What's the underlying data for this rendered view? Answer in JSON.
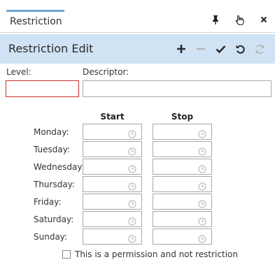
{
  "window": {
    "tab_label": "Restriction",
    "icons": [
      "pin-icon",
      "hand-pointer-icon",
      "close-icon"
    ]
  },
  "header": {
    "title": "Restriction Edit",
    "toolbar": [
      "add-icon",
      "remove-icon",
      "check-icon",
      "undo-icon",
      "refresh-icon"
    ]
  },
  "form": {
    "level_label": "Level:",
    "level_value": "",
    "descriptor_label": "Descriptor:",
    "descriptor_value": ""
  },
  "schedule": {
    "start_header": "Start",
    "stop_header": "Stop",
    "days": [
      {
        "label": "Monday:",
        "start": "",
        "stop": ""
      },
      {
        "label": "Tuesday:",
        "start": "",
        "stop": ""
      },
      {
        "label": "Wednesday:",
        "start": "",
        "stop": ""
      },
      {
        "label": "Thursday:",
        "start": "",
        "stop": ""
      },
      {
        "label": "Friday:",
        "start": "",
        "stop": ""
      },
      {
        "label": "Saturday:",
        "start": "",
        "stop": ""
      },
      {
        "label": "Sunday:",
        "start": "",
        "stop": ""
      }
    ]
  },
  "permission_checkbox": {
    "label": "This is a permission and not restriction",
    "checked": false
  },
  "colors": {
    "header_bg": "#cfe3f4",
    "tab_accent": "#6fa6d6",
    "error_border": "#c9302c",
    "toolbar_icon": "#333333",
    "toolbar_icon_disabled": "#b5b5b5"
  }
}
